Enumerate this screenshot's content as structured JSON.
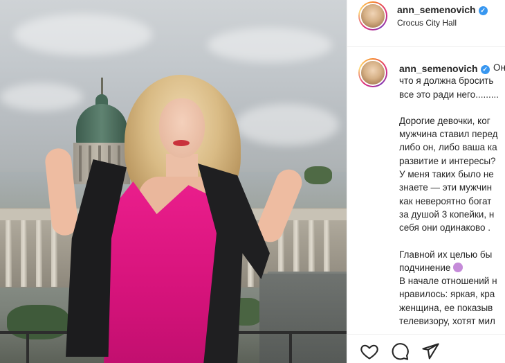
{
  "post": {
    "header": {
      "username": "ann_semenovich",
      "location": "Crocus City Hall"
    },
    "caption": {
      "username": "ann_semenovich",
      "lines": [
        "Он",
        "что я должна бросить",
        "все это ради него.........",
        "",
        "Дорогие девочки, ког",
        "мужчина ставил перед",
        "либо он, либо ваша ка",
        "развитие и интересы?",
        "У меня таких было не",
        "знаете — эти мужчин",
        "как невероятно богат",
        "за душой 3 копейки, н",
        "себя они одинаково .",
        "",
        "Главной их целью бы",
        "подчинение",
        "В начале отношений н",
        "нравилось: яркая, кра",
        "женщина, ее показыв",
        "телевизору, хотят мил"
      ]
    },
    "icons": {
      "verified": "verified-badge-icon",
      "like": "heart-icon",
      "comment": "comment-bubble-icon",
      "share": "paper-plane-icon"
    },
    "colors": {
      "verified": "#3897f0",
      "text": "#262626",
      "dress": "#e01a86"
    }
  }
}
